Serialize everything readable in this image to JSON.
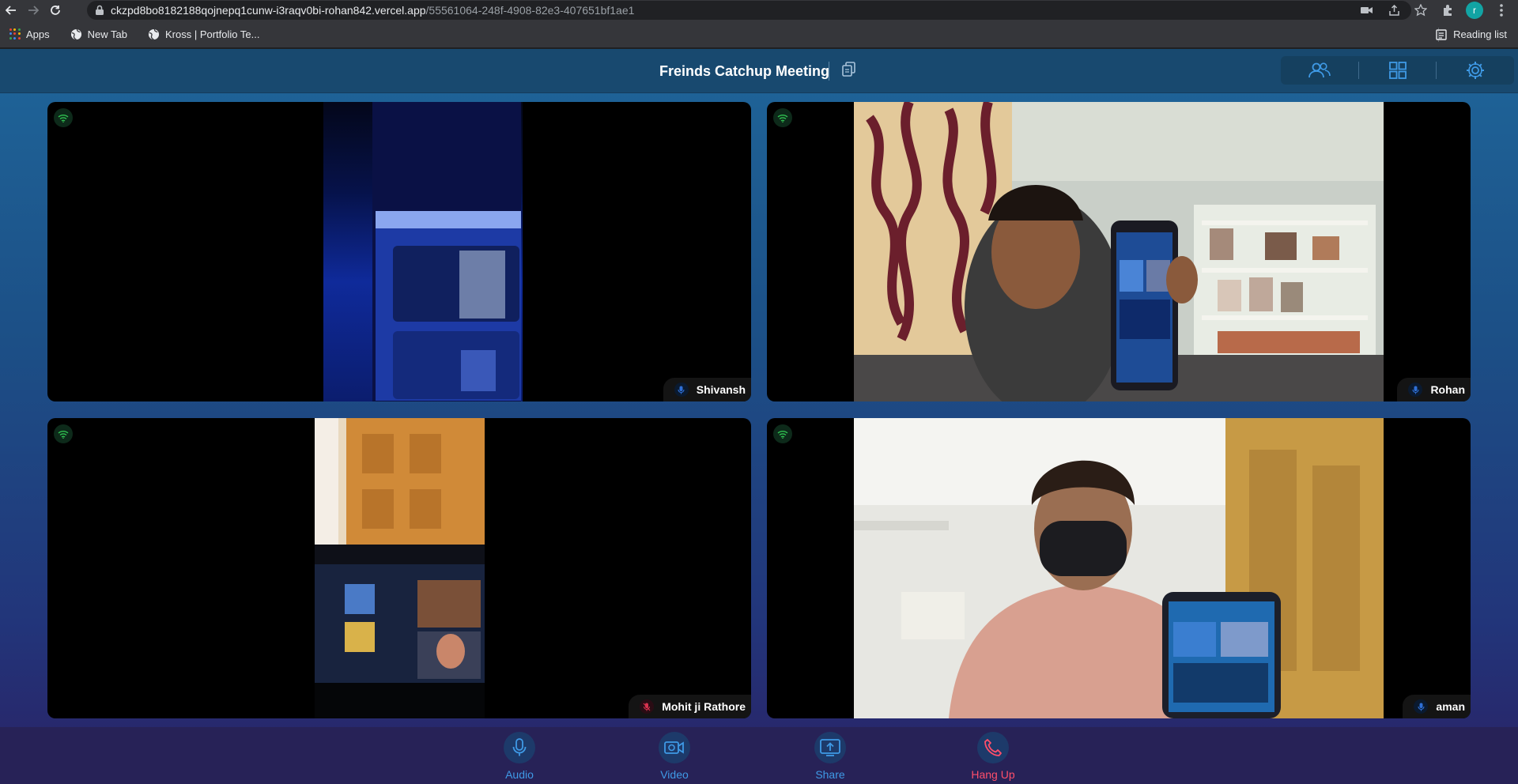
{
  "browser": {
    "url_host": "ckzpd8bo8182188qojnepq1cunw-i3raqv0bi-rohan842.vercel.app",
    "url_path": "/55561064-248f-4908-82e3-407651bf1ae1",
    "profile_initial": "r",
    "bookmarks": [
      "Apps",
      "New Tab",
      "Kross | Portfolio Te..."
    ],
    "reading_list_label": "Reading list"
  },
  "meeting": {
    "title": "Freinds Catchup Meeting"
  },
  "participants": [
    {
      "name": "Shivansh",
      "mic": "on"
    },
    {
      "name": "Rohan",
      "mic": "on"
    },
    {
      "name": "Mohit ji Rathore",
      "mic": "muted"
    },
    {
      "name": "aman",
      "mic": "on"
    }
  ],
  "controls": {
    "audio_label": "Audio",
    "video_label": "Video",
    "share_label": "Share",
    "hangup_label": "Hang Up"
  },
  "colors": {
    "accent": "#3f9ae6",
    "danger": "#ff4f6b",
    "signal": "#2fbf50"
  }
}
